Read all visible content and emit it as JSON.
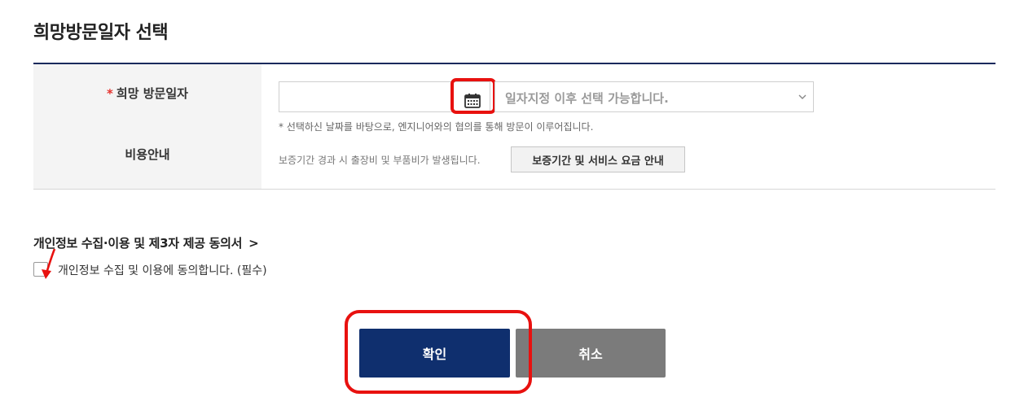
{
  "section": {
    "title": "희망방문일자 선택"
  },
  "form": {
    "visit_date": {
      "required_mark": "*",
      "label": "희망 방문일자",
      "date_value": "",
      "select_value": "일자지정 이후 선택 가능합니다.",
      "note": "* 선택하신 날짜를 바탕으로, 엔지니어와의 협의를 통해 방문이 이루어집니다."
    },
    "cost": {
      "label": "비용안내",
      "text": "보증기간 경과 시 출장비 및 부품비가 발생됩니다.",
      "button_label": "보증기간 및 서비스 요금 안내"
    }
  },
  "consent": {
    "title": "개인정보 수집·이용 및 제3자 제공 동의서",
    "title_arrow": ">",
    "checkbox_label": "개인정보 수집 및 이용에 동의합니다. (필수)",
    "checked": false
  },
  "actions": {
    "confirm_label": "확인",
    "cancel_label": "취소"
  },
  "icons": {
    "calendar": "calendar-icon",
    "select_arrow": "chevron-down-icon"
  },
  "colors": {
    "primary": "#0f2f6e",
    "secondary": "#7b7b7b",
    "required": "#e5322d",
    "annotation": "#e8110f"
  }
}
